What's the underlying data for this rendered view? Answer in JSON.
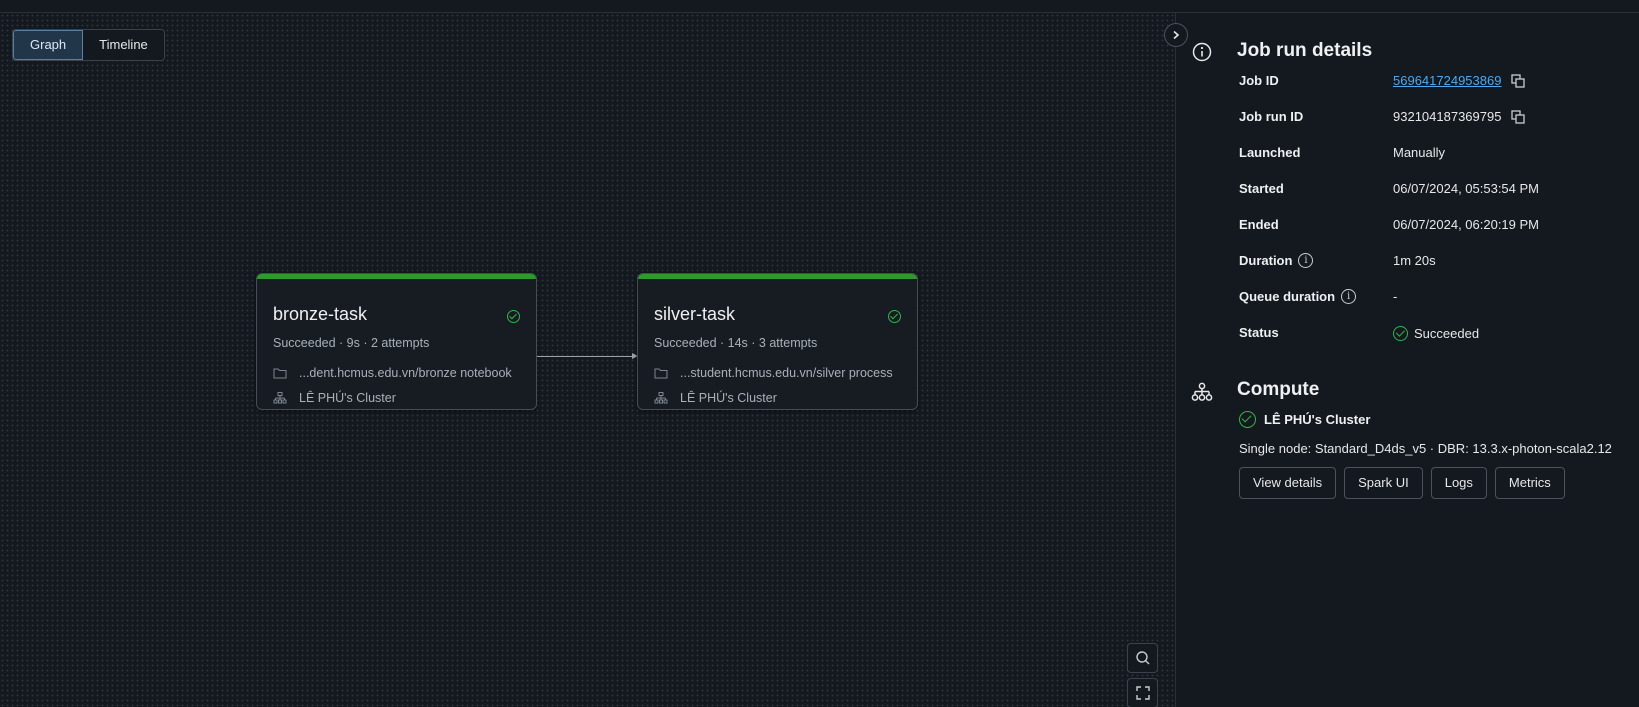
{
  "view_toggle": {
    "graph_label": "Graph",
    "timeline_label": "Timeline",
    "selected": "Graph"
  },
  "tasks": [
    {
      "name": "bronze-task",
      "summary": "Succeeded · 9s · 2 attempts",
      "notebook_path": "...dent.hcmus.edu.vn/bronze notebook",
      "cluster": "LÊ PHÚ's Cluster",
      "status_icon": "check-circle-icon"
    },
    {
      "name": "silver-task",
      "summary": "Succeeded · 14s · 3 attempts",
      "notebook_path": "...student.hcmus.edu.vn/silver process",
      "cluster": "LÊ PHÚ's Cluster",
      "status_icon": "check-circle-icon"
    }
  ],
  "job_run_details": {
    "heading": "Job run details",
    "fields": {
      "job_id_label": "Job ID",
      "job_id": "569641724953869",
      "job_run_id_label": "Job run ID",
      "job_run_id": "932104187369795",
      "launched_label": "Launched",
      "launched": "Manually",
      "started_label": "Started",
      "started": "06/07/2024, 05:53:54 PM",
      "ended_label": "Ended",
      "ended": "06/07/2024, 06:20:19 PM",
      "duration_label": "Duration",
      "duration": "1m 20s",
      "queue_duration_label": "Queue duration",
      "queue_duration": "-",
      "status_label": "Status",
      "status": "Succeeded"
    }
  },
  "compute": {
    "heading": "Compute",
    "cluster_name": "LÊ PHÚ's Cluster",
    "spec": "Single node: Standard_D4ds_v5 · DBR: 13.3.x-photon-scala2.12",
    "buttons": {
      "view_details": "View details",
      "spark_ui": "Spark UI",
      "logs": "Logs",
      "metrics": "Metrics"
    }
  },
  "colors": {
    "success": "#37b24d",
    "task_bar": "#2e9a2e",
    "link": "#4ea8f0",
    "background": "#14191f"
  }
}
